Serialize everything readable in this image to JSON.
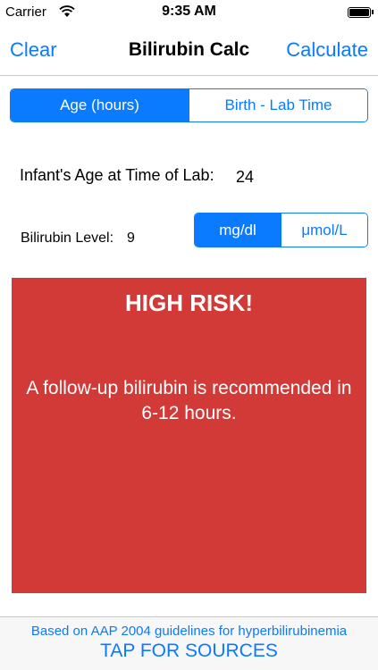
{
  "status_bar": {
    "carrier": "Carrier",
    "time": "9:35 AM",
    "wifi_icon": "wifi-icon",
    "battery_icon": "battery-icon"
  },
  "nav": {
    "left_label": "Clear",
    "title": "Bilirubin Calc",
    "right_label": "Calculate"
  },
  "mode_segment": {
    "options": [
      "Age (hours)",
      "Birth - Lab Time"
    ],
    "selected": "Age (hours)"
  },
  "age": {
    "label": "Infant's Age at Time of Lab:",
    "value": "24"
  },
  "bilirubin": {
    "label": "Bilirubin Level:",
    "value": "9"
  },
  "units_segment": {
    "options": [
      "mg/dl",
      "μmol/L"
    ],
    "selected": "mg/dl"
  },
  "result": {
    "title": "HIGH RISK!",
    "message": "A follow-up bilirubin is recommended in 6-12 hours.",
    "color": "#d13a37"
  },
  "footer": {
    "note": "Based on AAP 2004 guidelines for hyperbilirubinemia",
    "link": "TAP FOR SOURCES"
  },
  "colors": {
    "accent": "#0a7aff"
  }
}
